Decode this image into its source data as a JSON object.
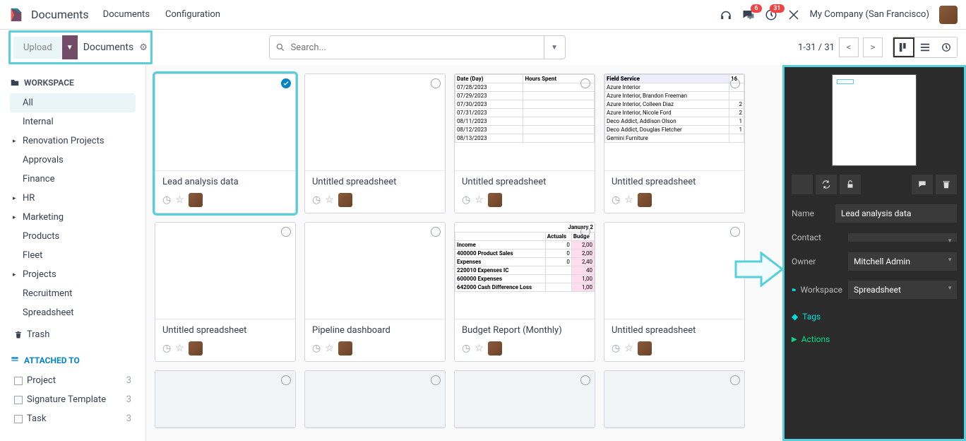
{
  "topnav": {
    "brand": "Documents",
    "links": [
      "Documents",
      "Configuration"
    ],
    "msg_badge": "6",
    "activity_badge": "31",
    "company": "My Company (San Francisco)"
  },
  "toolbar": {
    "upload": "Upload",
    "workspace_name": "Documents",
    "search_placeholder": "Search...",
    "pager": "1-31 / 31"
  },
  "sidebar": {
    "workspace_header": "WORKSPACE",
    "items": [
      {
        "label": "All",
        "active": true
      },
      {
        "label": "Internal"
      },
      {
        "label": "Renovation Projects",
        "caret": true
      },
      {
        "label": "Approvals"
      },
      {
        "label": "Finance"
      },
      {
        "label": "HR",
        "caret": true
      },
      {
        "label": "Marketing",
        "caret": true
      },
      {
        "label": "Products"
      },
      {
        "label": "Fleet"
      },
      {
        "label": "Projects",
        "caret": true
      },
      {
        "label": "Recruitment"
      },
      {
        "label": "Spreadsheet"
      }
    ],
    "trash": "Trash",
    "attached_header": "ATTACHED TO",
    "attached": [
      {
        "label": "Project",
        "count": 3
      },
      {
        "label": "Signature Template",
        "count": 3
      },
      {
        "label": "Task",
        "count": 3
      }
    ]
  },
  "cards": [
    {
      "title": "Lead analysis data",
      "selected": true
    },
    {
      "title": "Untitled spreadsheet"
    },
    {
      "title": "Untitled spreadsheet",
      "thumb": "dates"
    },
    {
      "title": "Untitled spreadsheet",
      "thumb": "field"
    },
    {
      "title": "Untitled spreadsheet"
    },
    {
      "title": "Pipeline dashboard"
    },
    {
      "title": "Budget Report (Monthly)",
      "thumb": "budget"
    },
    {
      "title": "Untitled spreadsheet"
    }
  ],
  "thumbs": {
    "dates": {
      "head": [
        "Date (Day)",
        "Hours Spent"
      ],
      "rows": [
        "07/28/2023",
        "07/29/2023",
        "07/30/2023",
        "07/31/2023",
        "08/11/2023",
        "08/12/2023",
        "08/13/2023"
      ]
    },
    "field": {
      "head": "Field Service",
      "head_v": "16",
      "rows": [
        [
          "Azure Interior",
          ""
        ],
        [
          "Azure Interior, Brandon Freeman",
          ""
        ],
        [
          "Azure Interior, Colleen Diaz",
          "2"
        ],
        [
          "Azure Interior, Nicole Ford",
          "2"
        ],
        [
          "Deco Addict, Addison Olson",
          "1"
        ],
        [
          "Deco Addict, Douglas Fletcher",
          "1"
        ],
        [
          "Gemini Furniture",
          ""
        ]
      ]
    },
    "budget": {
      "month": "January 2",
      "cols": [
        "Actuals",
        "Budge"
      ],
      "rows": [
        [
          "Income",
          "0",
          "2,00"
        ],
        [
          "400000 Product Sales",
          "0",
          "2,00"
        ],
        [
          "Expenses",
          "0",
          "2,40"
        ],
        [
          "220010 Expenses IC",
          "",
          "40"
        ],
        [
          "600000 Expenses",
          "",
          "1,00"
        ],
        [
          "642000 Cash Difference Loss",
          "",
          "1,00"
        ]
      ]
    }
  },
  "panel": {
    "name_lbl": "Name",
    "name_val": "Lead analysis data",
    "contact_lbl": "Contact",
    "contact_val": "",
    "owner_lbl": "Owner",
    "owner_val": "Mitchell Admin",
    "workspace_lbl": "Workspace",
    "workspace_val": "Spreadsheet",
    "tags_lbl": "Tags",
    "actions_lbl": "Actions"
  }
}
